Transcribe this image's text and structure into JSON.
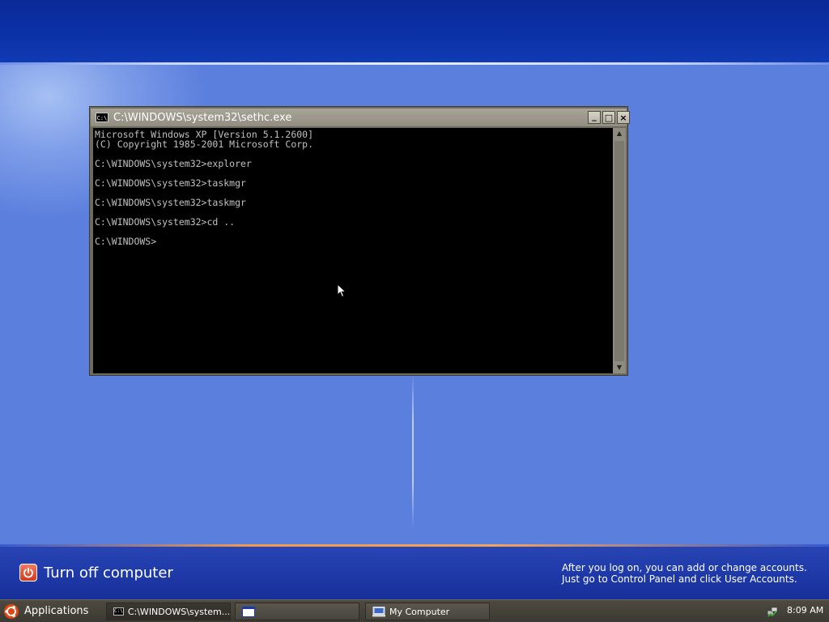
{
  "console": {
    "title": "C:\\WINDOWS\\system32\\sethc.exe",
    "app_icon_text": "C:\\",
    "lines": [
      "Microsoft Windows XP [Version 5.1.2600]",
      "(C) Copyright 1985-2001 Microsoft Corp.",
      "",
      "C:\\WINDOWS\\system32>explorer",
      "",
      "C:\\WINDOWS\\system32>taskmgr",
      "",
      "C:\\WINDOWS\\system32>taskmgr",
      "",
      "C:\\WINDOWS\\system32>cd ..",
      "",
      "C:\\WINDOWS>"
    ],
    "buttons": {
      "minimize": "_",
      "maximize": "□",
      "close": "×"
    }
  },
  "login_screen": {
    "turn_off_label": "Turn off computer",
    "hint_line1": "After you log on, you can add or change accounts.",
    "hint_line2": "Just go to Control Panel and click User Accounts."
  },
  "taskbar": {
    "applications_label": "Applications",
    "tasks": [
      {
        "label": "C:\\WINDOWS\\system...",
        "icon": "console-icon"
      },
      {
        "label": "",
        "icon": "window-icon"
      },
      {
        "label": "My Computer",
        "icon": "computer-icon"
      }
    ],
    "clock": "8:09 AM"
  },
  "colors": {
    "desktop_blue": "#5a7edc",
    "top_band": "#0c32a8",
    "console_bg": "#000000",
    "console_text": "#c0c0c0",
    "turn_off_red": "#d4391c"
  }
}
